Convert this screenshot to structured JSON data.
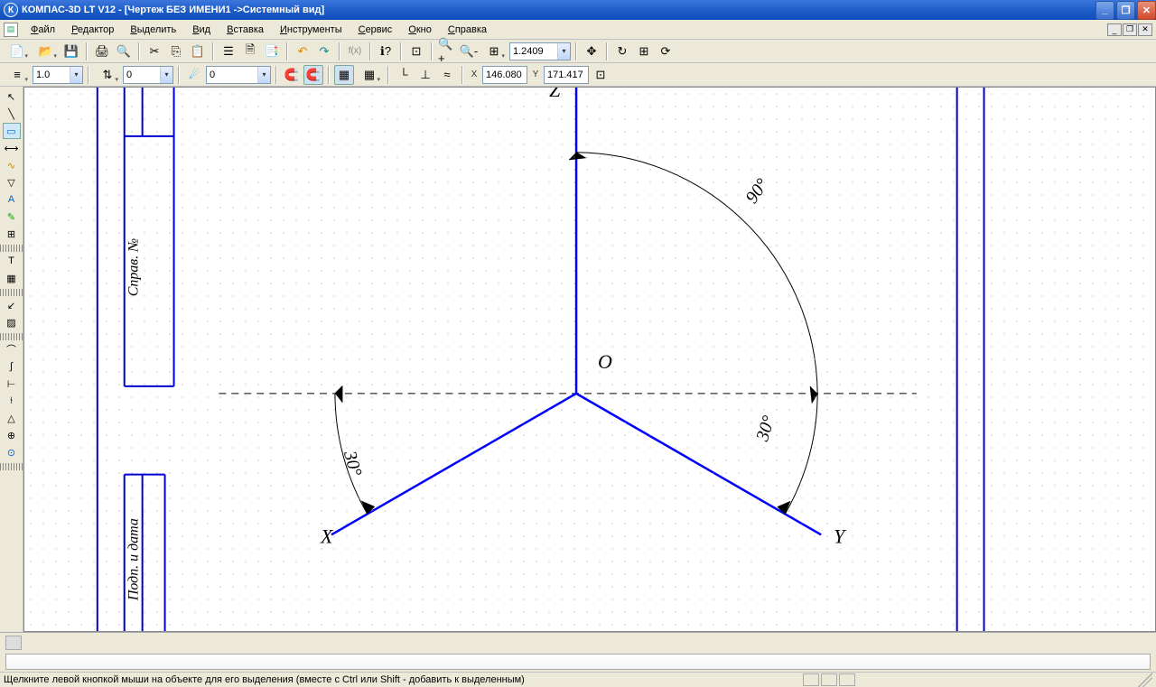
{
  "title": "КОМПАС-3D LT V12 - [Чертеж БЕЗ ИМЕНИ1 ->Системный вид]",
  "app_icon": "К",
  "menu": {
    "file": "Файл",
    "editor": "Редактор",
    "select": "Выделить",
    "view": "Вид",
    "insert": "Вставка",
    "tools": "Инструменты",
    "service": "Сервис",
    "window": "Окно",
    "help": "Справка"
  },
  "toolbar2": {
    "scale_sel": "1.0",
    "layer_sel": "0",
    "zoom_value": "1.2409",
    "coord_x_label": "X",
    "coord_y_label": "Y",
    "coord_x": "146.080",
    "coord_y": "171.417"
  },
  "drawing": {
    "origin_label": "О",
    "axis_x": "X",
    "axis_y": "Y",
    "axis_z": "Z",
    "angle_30_left": "30°",
    "angle_30_right": "30°",
    "angle_90": "90°",
    "sideblock_top": "Справ. №",
    "sideblock_bottom": "Подп. и дата"
  },
  "status_text": "Щелкните левой кнопкой мыши на объекте для его выделения (вместе с Ctrl или Shift - добавить к выделенным)"
}
